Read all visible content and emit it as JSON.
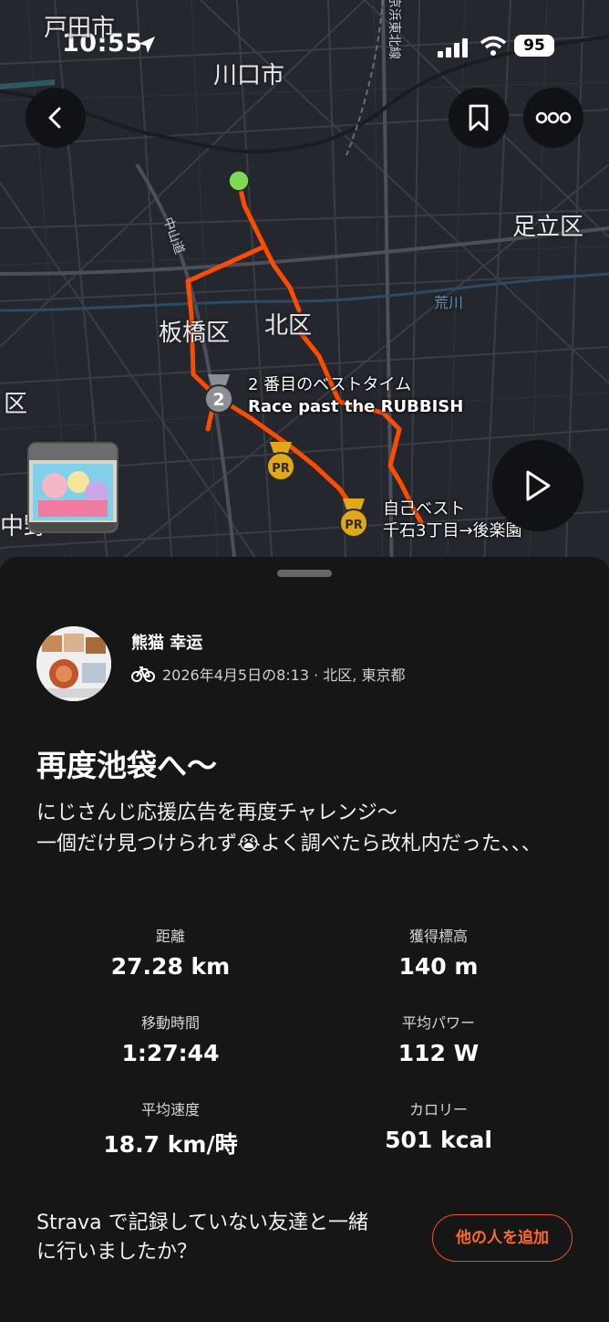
{
  "status_bar": {
    "time": "10:55",
    "battery": "95"
  },
  "map": {
    "labels": {
      "toda": "戸田市",
      "kawaguchi": "川口市",
      "adachi": "足立区",
      "itabashi": "板橋区",
      "kita": "北区",
      "ku_left": "区",
      "nakano_left": "中野",
      "nakasendo": "中山道",
      "arakawa": "荒川",
      "rail": "京浜東北線"
    },
    "segments": [
      {
        "line1": "2 番目のベストタイム",
        "line2": "Race past the RUBBISH"
      },
      {
        "line1": "自己ベスト",
        "line2": "千石3丁目→後楽園"
      }
    ],
    "medal_number": "2",
    "pr_text": "PR",
    "colors": {
      "route": "#fc4c02",
      "start": "#7ed957"
    }
  },
  "activity": {
    "athlete_name": "熊猫 幸运",
    "meta": "2026年4月5日の8:13 · 北区, 東京都",
    "title": "再度池袋へ〜",
    "description": "にじさんじ応援広告を再度チャレンジ〜\n一個だけ見つけられず😭よく調べたら改札内だった、、、",
    "stats": [
      {
        "label": "距離",
        "value": "27.28 km"
      },
      {
        "label": "獲得標高",
        "value": "140 m"
      },
      {
        "label": "移動時間",
        "value": "1:27:44"
      },
      {
        "label": "平均パワー",
        "value": "112 W"
      },
      {
        "label": "平均速度",
        "value": "18.7 km/時"
      },
      {
        "label": "カロリー",
        "value": "501 kcal"
      }
    ],
    "invite_text": "Strava で記録していない友達と一緒\nに行いましたか？",
    "add_button": "他の人を追加"
  }
}
